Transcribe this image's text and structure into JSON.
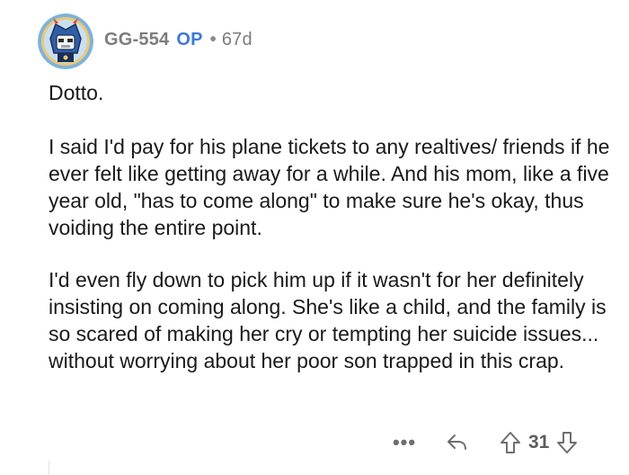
{
  "comment": {
    "author": "GG-554",
    "op_badge": "OP",
    "separator": "•",
    "age": "67d",
    "avatar_icon": "robot-avatar-icon",
    "paragraphs": [
      "Dotto.",
      "I said I'd pay for his plane tickets to any realtives/ friends if he ever felt like getting away for a while. And his mom, like a five year old, \"has to come along\" to make sure he's okay, thus voiding the entire point.",
      "I'd even fly down to pick him up if it wasn't for her definitely insisting on coming along. She's like a child, and the family is so scared of making her cry or tempting her suicide issues... without worrying about her poor son trapped in this crap."
    ]
  },
  "actions": {
    "more_label": "•••",
    "reply_icon": "reply-icon",
    "upvote_icon": "upvote-icon",
    "score": "31",
    "downvote_icon": "downvote-icon"
  },
  "colors": {
    "op_badge": "#3f7ad6",
    "meta_gray": "#7c7c7c",
    "text": "#1a1a1a",
    "icon_gray": "#6e6e6e"
  }
}
